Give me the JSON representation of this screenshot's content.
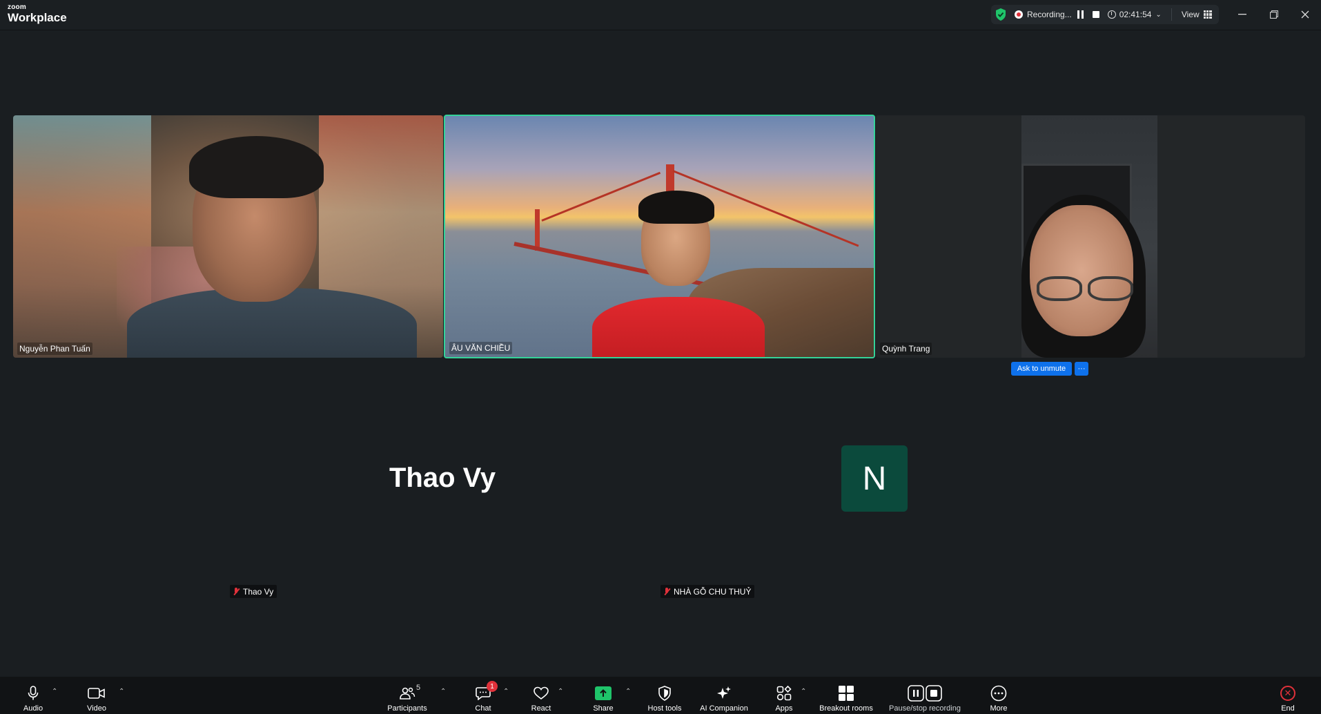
{
  "app": {
    "brand_small": "zoom",
    "brand_big": "Workplace"
  },
  "recording": {
    "status": "Recording...",
    "timer": "02:41:54",
    "view_label": "View"
  },
  "participants_tiles": [
    {
      "name": "Nguyễn Phan Tuấn"
    },
    {
      "name": "ÂU VĂN CHIỀU"
    },
    {
      "name": "Quỳnh Trang",
      "ask_unmute": "Ask to unmute",
      "more": "···"
    }
  ],
  "audio_only": [
    {
      "display": "Thao Vy",
      "tag": "Thao Vy"
    },
    {
      "avatar_letter": "N",
      "tag": "NHÀ GỖ CHU THUỶ",
      "avatar_color": "#0b4a3c"
    }
  ],
  "toolbar": {
    "audio": "Audio",
    "video": "Video",
    "participants": "Participants",
    "participants_count": "5",
    "chat": "Chat",
    "chat_badge": "1",
    "react": "React",
    "share": "Share",
    "host_tools": "Host tools",
    "ai_companion": "AI Companion",
    "apps": "Apps",
    "breakout": "Breakout rooms",
    "pause_stop": "Pause/stop recording",
    "more": "More",
    "end": "End"
  },
  "colors": {
    "active_speaker_border": "#34d399",
    "share_green": "#1fc46a",
    "end_red": "#e0313a",
    "unmute_blue": "#0e71eb"
  },
  "icons": [
    "shield-check-icon",
    "record-icon",
    "pause-icon",
    "stop-icon",
    "clock-icon",
    "grid-view-icon",
    "minimize-icon",
    "restore-icon",
    "close-icon",
    "mic-icon",
    "camera-icon",
    "people-icon",
    "chat-icon",
    "heart-icon",
    "share-arrow-icon",
    "shield-icon",
    "sparkle-icon",
    "apps-icon",
    "breakout-icon",
    "pause-stop-icon",
    "more-icon",
    "end-icon",
    "mic-off-icon"
  ]
}
